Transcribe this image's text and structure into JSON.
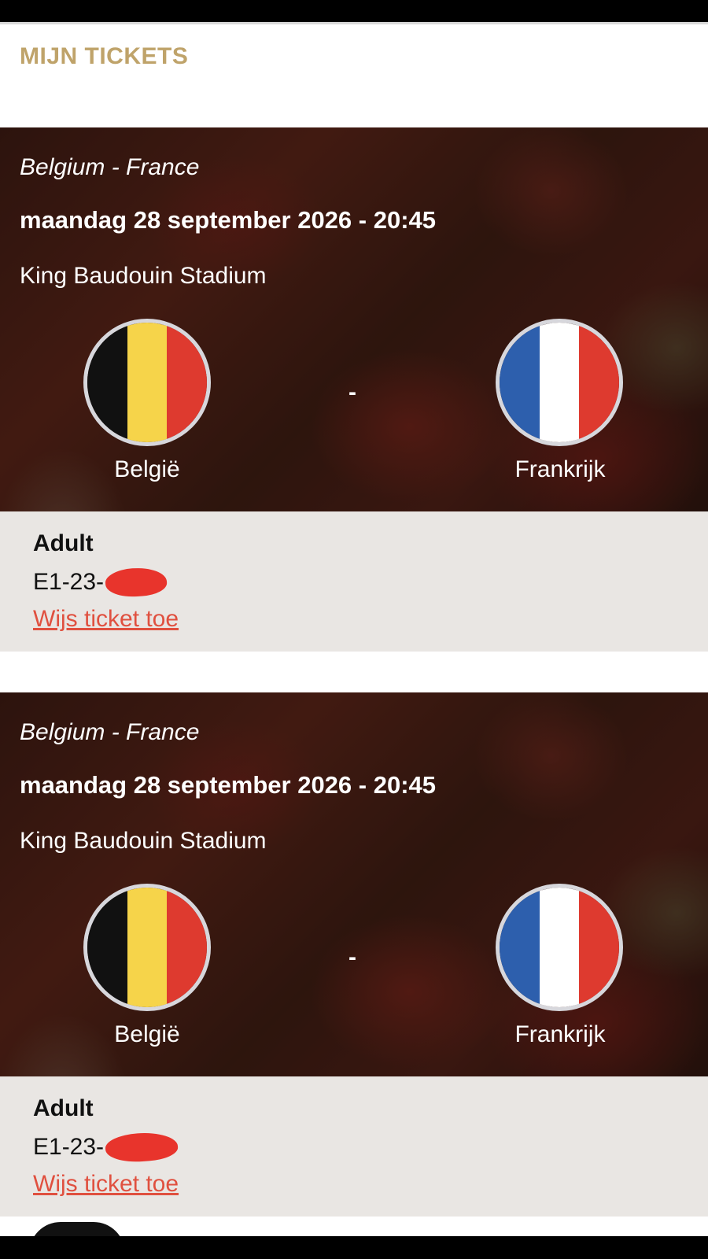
{
  "header": {
    "title": "MIJN TICKETS"
  },
  "colors": {
    "accent_gold": "#bfa36a",
    "link_red": "#e0503f",
    "info_bg": "#e9e6e3",
    "belgium_flag": [
      "#111111",
      "#f6d44a",
      "#de3a2f"
    ],
    "france_flag": [
      "#2d5fad",
      "#ffffff",
      "#de3a2f"
    ]
  },
  "tickets": [
    {
      "match": "Belgium - France",
      "datetime": "maandag 28 september 2026 - 20:45",
      "venue": "King Baudouin Stadium",
      "home_team": "België",
      "away_team": "Frankrijk",
      "separator": "-",
      "home_flag_icon": "belgium-flag-icon",
      "away_flag_icon": "france-flag-icon",
      "ticket_type": "Adult",
      "ticket_code": "E1-23-",
      "action_label": "Wijs ticket toe"
    },
    {
      "match": "Belgium - France",
      "datetime": "maandag 28 september 2026 - 20:45",
      "venue": "King Baudouin Stadium",
      "home_team": "België",
      "away_team": "Frankrijk",
      "separator": "-",
      "home_flag_icon": "belgium-flag-icon",
      "away_flag_icon": "france-flag-icon",
      "ticket_type": "Adult",
      "ticket_code": "E1-23-",
      "action_label": "Wijs ticket toe"
    }
  ]
}
